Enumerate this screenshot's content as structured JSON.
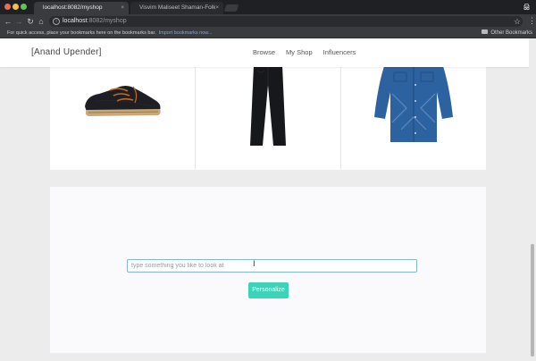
{
  "browser": {
    "tabs": [
      {
        "title": "localhost:8082/myshop",
        "active": true
      },
      {
        "title": "Visvim Maliseet Shaman-Folk",
        "active": false
      }
    ],
    "close_glyph": "×",
    "url_host": "localhost",
    "url_rest": ":8082/myshop",
    "bookmarks_prompt": "For quick access, place your bookmarks here on the bookmarks bar.",
    "bookmarks_import_link": "Import bookmarks now...",
    "other_bookmarks": "Other Bookmarks"
  },
  "page": {
    "brand": "[Anand Upender]",
    "nav": [
      "Browse",
      "My Shop",
      "Influencers"
    ],
    "products": [
      {
        "icon": "shoe-image"
      },
      {
        "icon": "jeans-image"
      },
      {
        "icon": "denim-shirt-image"
      }
    ],
    "search": {
      "placeholder": "type something you like to look at",
      "value": ""
    },
    "personalize_label": "Personalize"
  },
  "colors": {
    "accent": "#3cd3b8",
    "input_border": "#7fb7e3",
    "chrome_dark": "#3a3b3f"
  }
}
